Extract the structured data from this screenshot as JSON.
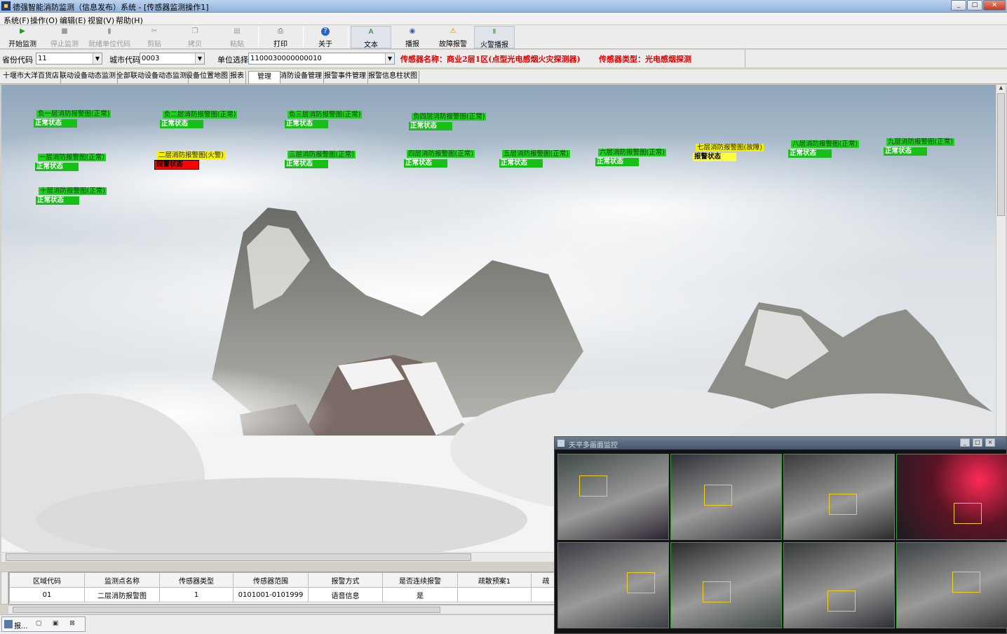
{
  "window": {
    "title": "德强智能消防监测（信息发布）系统 - [传感器监测操作1]",
    "controls": [
      "_",
      "□",
      "×"
    ]
  },
  "menu": [
    "系统(F)",
    "操作(O)",
    "编辑(E)",
    "视窗(V)",
    "帮助(H)"
  ],
  "toolbar": [
    {
      "label": "开始监测",
      "icon": "▶",
      "state": "enabled"
    },
    {
      "label": "停止监测",
      "icon": "■",
      "state": "disabled"
    },
    {
      "label": "就绪单位代码",
      "icon": "▮",
      "state": "disabled"
    },
    {
      "label": "剪贴",
      "icon": "✂",
      "state": "disabled"
    },
    {
      "label": "拷贝",
      "icon": "❐",
      "state": "disabled"
    },
    {
      "label": "粘贴",
      "icon": "▤",
      "state": "disabled"
    },
    {
      "label": "打印",
      "icon": "⎙",
      "state": "enabled"
    },
    {
      "label": "关于",
      "icon": "?",
      "state": "enabled"
    },
    {
      "label": "文本",
      "icon": "A",
      "state": "pressed"
    },
    {
      "label": "播报",
      "icon": "◉",
      "state": "enabled"
    },
    {
      "label": "故障报警",
      "icon": "⚠",
      "state": "enabled"
    },
    {
      "label": "火警播报",
      "icon": "Ⅱ",
      "state": "pressed"
    }
  ],
  "filters": {
    "province_label": "省份代码",
    "province_value": "11",
    "city_label": "城市代码",
    "city_value": "0003",
    "unit_label": "单位选择",
    "unit_value": "1100030000000010",
    "sensor_name": "传感器名称：商业2层1区(点型光电感烟火灾探测器)",
    "sensor_type": "传感器类型：光电感烟探测"
  },
  "tabs": [
    "十堰市大洋百货店",
    "联动设备动态监测",
    "全部联动设备动态监测",
    "设备位置地图",
    "报表",
    "管理",
    "消防设备管理",
    "报警事件管理",
    "报警信息柱状图"
  ],
  "active_tab": 5,
  "sensors": [
    {
      "name": "负一层消防报警图(正常)",
      "status": "正常状态",
      "kind": "normal"
    },
    {
      "name": "负二层消防报警图(正常)",
      "status": "正常状态",
      "kind": "normal"
    },
    {
      "name": "负三层消防报警图(正常)",
      "status": "正常状态",
      "kind": "normal"
    },
    {
      "name": "负四层消防报警图(正常)",
      "status": "正常状态",
      "kind": "normal"
    },
    {
      "name": "一层消防报警图(正常)",
      "status": "正常状态",
      "kind": "normal"
    },
    {
      "name": "二层消防报警图(火警)",
      "status": "报警状态",
      "kind": "fire"
    },
    {
      "name": "三层消防报警图(正常)",
      "status": "正常状态",
      "kind": "normal"
    },
    {
      "name": "四层消防报警图(正常)",
      "status": "正常状态",
      "kind": "normal"
    },
    {
      "name": "五层消防报警图(正常)",
      "status": "正常状态",
      "kind": "normal"
    },
    {
      "name": "六层消防报警图(正常)",
      "status": "正常状态",
      "kind": "normal"
    },
    {
      "name": "七层消防报警图(故障)",
      "status": "报警状态",
      "kind": "fault"
    },
    {
      "name": "八层消防报警图(正常)",
      "status": "正常状态",
      "kind": "normal"
    },
    {
      "name": "九层消防报警图(正常)",
      "status": "正常状态",
      "kind": "normal"
    },
    {
      "name": "十层消防报警图(正常)",
      "status": "正常状态",
      "kind": "normal"
    }
  ],
  "grid": {
    "columns": [
      "区域代码",
      "监测点名称",
      "传感器类型",
      "传感器范围",
      "报警方式",
      "是否连续报警",
      "疏散预案1",
      "疏"
    ],
    "rows": [
      [
        "01",
        "二层消防报警图",
        "1",
        "0101001-0101999",
        "语音信息",
        "是",
        "",
        ""
      ]
    ]
  },
  "taskbar": {
    "label": "报...",
    "buttons": [
      "▢",
      "▣",
      "⊠"
    ]
  },
  "cctv": {
    "title": "天平多画面监控"
  },
  "colors": {
    "normal": "#22d022",
    "fire": "#ff0000",
    "fault": "#ffff40",
    "alert_text": "#e00000"
  }
}
